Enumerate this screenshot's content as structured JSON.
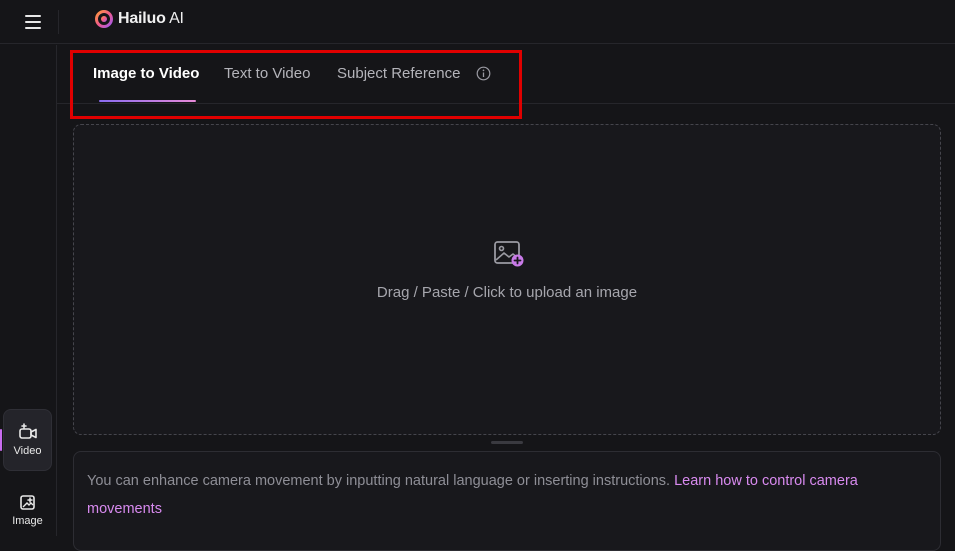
{
  "header": {
    "logo_text": "Hailuo",
    "logo_suffix": " AI"
  },
  "sidebar": {
    "items": [
      {
        "label": "Video",
        "icon": "video-plus-icon",
        "active": true
      },
      {
        "label": "Image",
        "icon": "image-plus-icon",
        "active": false
      }
    ]
  },
  "tabs": [
    {
      "label": "Image to Video",
      "active": true
    },
    {
      "label": "Text to Video",
      "active": false
    },
    {
      "label": "Subject Reference",
      "active": false,
      "icon": "info-icon"
    }
  ],
  "upload": {
    "icon": "image-add-icon",
    "text": "Drag / Paste / Click to upload an image"
  },
  "prompt": {
    "text": "You can enhance camera movement by inputting natural language or inserting instructions. ",
    "link": "Learn how to control camera movements"
  },
  "colors": {
    "accent": "#d88aef",
    "highlight": "#e00000",
    "background": "#151518"
  }
}
